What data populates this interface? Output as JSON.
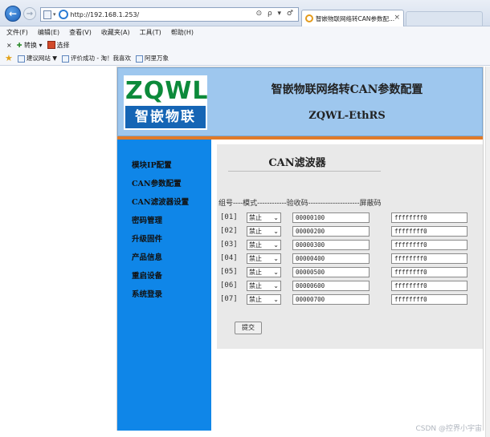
{
  "browser": {
    "url": "http://192.168.1.253/",
    "tab_title": "智嵌物联网络转CAN参数配...",
    "tab_close": "×",
    "addr_tools": "⊙ ρ ▾ ♂"
  },
  "menu": [
    "文件(F)",
    "编辑(E)",
    "查看(V)",
    "收藏夹(A)",
    "工具(T)",
    "帮助(H)"
  ],
  "commandbar": {
    "close": "×",
    "convert": "转换",
    "select": "选择"
  },
  "favorites": [
    "建议网站 ▼",
    "评价成功 - 淘！我喜欢",
    "阿里万象"
  ],
  "page": {
    "logo_top": "ZQWL",
    "logo_bottom": "智嵌物联",
    "title": "智嵌物联网络转CAN参数配置",
    "subtitle": "ZQWL-EthRS"
  },
  "sidebar": {
    "items": [
      "模块IP配置",
      "CAN参数配置",
      "CAN滤波器设置",
      "密码管理",
      "升级固件",
      "产品信息",
      "重启设备",
      "系统登录"
    ]
  },
  "panel": {
    "title": "CAN滤波器",
    "header": "组号----模式------------验收码---------------------屏蔽码",
    "submit": "提交"
  },
  "filters": [
    {
      "group": "[01]",
      "mode": "禁止",
      "code": "00000100",
      "mask": "ffffffff0"
    },
    {
      "group": "[02]",
      "mode": "禁止",
      "code": "00000200",
      "mask": "ffffffff0"
    },
    {
      "group": "[03]",
      "mode": "禁止",
      "code": "00000300",
      "mask": "ffffffff0"
    },
    {
      "group": "[04]",
      "mode": "禁止",
      "code": "00000400",
      "mask": "ffffffff0"
    },
    {
      "group": "[05]",
      "mode": "禁止",
      "code": "00000500",
      "mask": "ffffffff0"
    },
    {
      "group": "[06]",
      "mode": "禁止",
      "code": "00000600",
      "mask": "ffffffff0"
    },
    {
      "group": "[07]",
      "mode": "禁止",
      "code": "00000700",
      "mask": "ffffffff0"
    }
  ],
  "watermark": "CSDN @控界小宇宙",
  "colors": {
    "header_bg": "#9ec7ee",
    "sidebar_bg": "#0f86e8",
    "accent_line": "#e07b2a",
    "logo_green": "#0c8a3a"
  }
}
